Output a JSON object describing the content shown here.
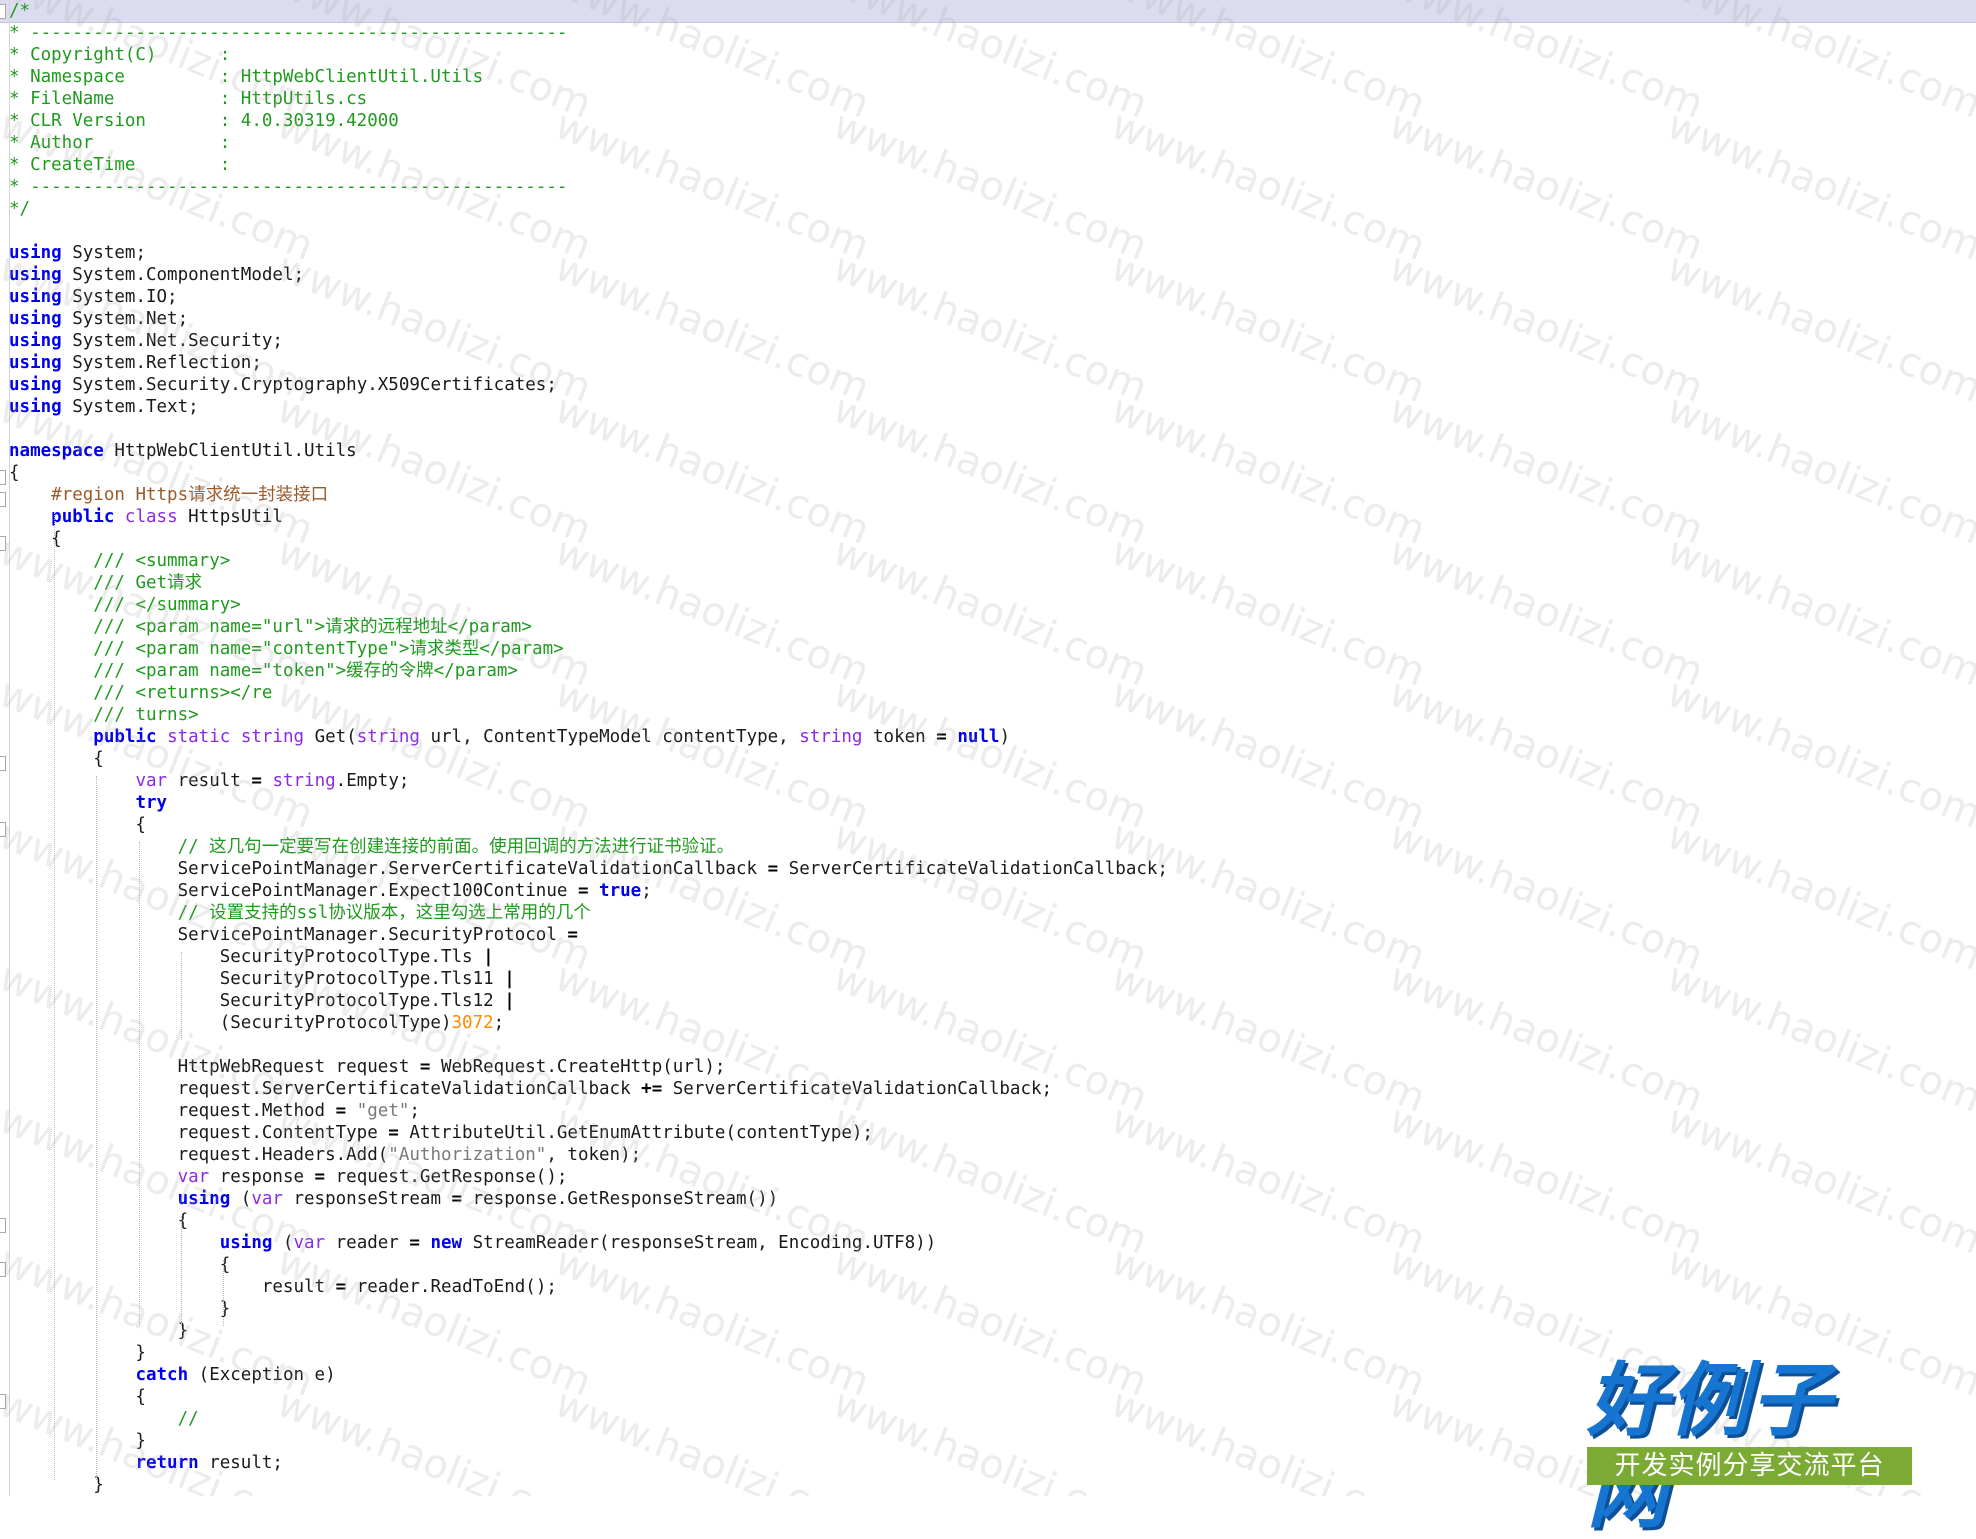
{
  "watermark": {
    "text": "www.haolizi.com"
  },
  "logo": {
    "title": "好例子网",
    "subtitle": "开发实例分享交流平台"
  },
  "code_lines": [
    [
      [
        "c",
        "/*"
      ]
    ],
    [
      [
        "c",
        "* ---------------------------------------------------"
      ]
    ],
    [
      [
        "c",
        "* Copyright(C)      :"
      ]
    ],
    [
      [
        "c",
        "* Namespace         : HttpWebClientUtil.Utils"
      ]
    ],
    [
      [
        "c",
        "* FileName          : HttpUtils.cs"
      ]
    ],
    [
      [
        "c",
        "* CLR Version       : 4.0.30319.42000"
      ]
    ],
    [
      [
        "c",
        "* Author            :"
      ]
    ],
    [
      [
        "c",
        "* CreateTime        :"
      ]
    ],
    [
      [
        "c",
        "* ---------------------------------------------------"
      ]
    ],
    [
      [
        "c",
        "*/"
      ]
    ],
    [],
    [
      [
        "k",
        "using"
      ],
      [
        "t",
        " System;"
      ]
    ],
    [
      [
        "k",
        "using"
      ],
      [
        "t",
        " System.ComponentModel;"
      ]
    ],
    [
      [
        "k",
        "using"
      ],
      [
        "t",
        " System.IO;"
      ]
    ],
    [
      [
        "k",
        "using"
      ],
      [
        "t",
        " System.Net;"
      ]
    ],
    [
      [
        "k",
        "using"
      ],
      [
        "t",
        " System.Net.Security;"
      ]
    ],
    [
      [
        "k",
        "using"
      ],
      [
        "t",
        " System.Reflection;"
      ]
    ],
    [
      [
        "k",
        "using"
      ],
      [
        "t",
        " System.Security.Cryptography.X509Certificates;"
      ]
    ],
    [
      [
        "k",
        "using"
      ],
      [
        "t",
        " System.Text;"
      ]
    ],
    [],
    [
      [
        "k",
        "namespace"
      ],
      [
        "t",
        " HttpWebClientUtil.Utils"
      ]
    ],
    [
      [
        "t",
        "{"
      ]
    ],
    [
      [
        "t",
        "    "
      ],
      [
        "r",
        "#region Https请求统一封装接口"
      ]
    ],
    [
      [
        "t",
        "    "
      ],
      [
        "k",
        "public"
      ],
      [
        "t",
        " "
      ],
      [
        "k2",
        "class"
      ],
      [
        "t",
        " HttpsUtil"
      ]
    ],
    [
      [
        "t",
        "    {"
      ]
    ],
    [
      [
        "t",
        "        "
      ],
      [
        "c",
        "/// <summary>"
      ]
    ],
    [
      [
        "t",
        "        "
      ],
      [
        "c",
        "/// Get请求"
      ]
    ],
    [
      [
        "t",
        "        "
      ],
      [
        "c",
        "/// </summary>"
      ]
    ],
    [
      [
        "t",
        "        "
      ],
      [
        "c",
        "/// <param name=\"url\">请求的远程地址</param>"
      ]
    ],
    [
      [
        "t",
        "        "
      ],
      [
        "c",
        "/// <param name=\"contentType\">请求类型</param>"
      ]
    ],
    [
      [
        "t",
        "        "
      ],
      [
        "c",
        "/// <param name=\"token\">缓存的令牌</param>"
      ]
    ],
    [
      [
        "t",
        "        "
      ],
      [
        "c",
        "/// <returns></re"
      ]
    ],
    [
      [
        "t",
        "        "
      ],
      [
        "c",
        "/// turns>"
      ]
    ],
    [
      [
        "t",
        "        "
      ],
      [
        "k",
        "public"
      ],
      [
        "t",
        " "
      ],
      [
        "k2",
        "static"
      ],
      [
        "t",
        " "
      ],
      [
        "k2",
        "string"
      ],
      [
        "t",
        " Get("
      ],
      [
        "k2",
        "string"
      ],
      [
        "t",
        " url, ContentTypeModel contentType, "
      ],
      [
        "k2",
        "string"
      ],
      [
        "t",
        " token "
      ],
      [
        "o",
        "="
      ],
      [
        "t",
        " "
      ],
      [
        "k",
        "null"
      ],
      [
        "t",
        ")"
      ]
    ],
    [
      [
        "t",
        "        {"
      ]
    ],
    [
      [
        "t",
        "            "
      ],
      [
        "k2",
        "var"
      ],
      [
        "t",
        " result "
      ],
      [
        "o",
        "="
      ],
      [
        "t",
        " "
      ],
      [
        "k2",
        "string"
      ],
      [
        "t",
        ".Empty;"
      ]
    ],
    [
      [
        "t",
        "            "
      ],
      [
        "k",
        "try"
      ]
    ],
    [
      [
        "t",
        "            {"
      ]
    ],
    [
      [
        "t",
        "                "
      ],
      [
        "c",
        "// 这几句一定要写在创建连接的前面。使用回调的方法进行证书验证。"
      ]
    ],
    [
      [
        "t",
        "                ServicePointManager.ServerCertificateValidationCallback "
      ],
      [
        "o",
        "="
      ],
      [
        "t",
        " ServerCertificateValidationCallback;"
      ]
    ],
    [
      [
        "t",
        "                ServicePointManager.Expect100Continue "
      ],
      [
        "o",
        "="
      ],
      [
        "t",
        " "
      ],
      [
        "k",
        "true"
      ],
      [
        "t",
        ";"
      ]
    ],
    [
      [
        "t",
        "                "
      ],
      [
        "c",
        "// 设置支持的ssl协议版本，这里勾选上常用的几个"
      ]
    ],
    [
      [
        "t",
        "                ServicePointManager.SecurityProtocol "
      ],
      [
        "o",
        "="
      ]
    ],
    [
      [
        "t",
        "                    SecurityProtocolType.Tls "
      ],
      [
        "o",
        "|"
      ]
    ],
    [
      [
        "t",
        "                    SecurityProtocolType.Tls11 "
      ],
      [
        "o",
        "|"
      ]
    ],
    [
      [
        "t",
        "                    SecurityProtocolType.Tls12 "
      ],
      [
        "o",
        "|"
      ]
    ],
    [
      [
        "t",
        "                    (SecurityProtocolType)"
      ],
      [
        "n",
        "3072"
      ],
      [
        "t",
        ";"
      ]
    ],
    [],
    [
      [
        "t",
        "                HttpWebRequest request "
      ],
      [
        "o",
        "="
      ],
      [
        "t",
        " WebRequest.CreateHttp(url);"
      ]
    ],
    [
      [
        "t",
        "                request.ServerCertificateValidationCallback "
      ],
      [
        "o",
        "+="
      ],
      [
        "t",
        " ServerCertificateValidationCallback;"
      ]
    ],
    [
      [
        "t",
        "                request.Method "
      ],
      [
        "o",
        "="
      ],
      [
        "t",
        " "
      ],
      [
        "s",
        "\"get\""
      ],
      [
        "t",
        ";"
      ]
    ],
    [
      [
        "t",
        "                request.ContentType "
      ],
      [
        "o",
        "="
      ],
      [
        "t",
        " AttributeUtil.GetEnumAttribute(contentType);"
      ]
    ],
    [
      [
        "t",
        "                request.Headers.Add("
      ],
      [
        "s",
        "\"Authorization\""
      ],
      [
        "t",
        ", token);"
      ]
    ],
    [
      [
        "t",
        "                "
      ],
      [
        "k2",
        "var"
      ],
      [
        "t",
        " response "
      ],
      [
        "o",
        "="
      ],
      [
        "t",
        " request.GetResponse();"
      ]
    ],
    [
      [
        "t",
        "                "
      ],
      [
        "k",
        "using"
      ],
      [
        "t",
        " ("
      ],
      [
        "k2",
        "var"
      ],
      [
        "t",
        " responseStream "
      ],
      [
        "o",
        "="
      ],
      [
        "t",
        " response.GetResponseStream())"
      ]
    ],
    [
      [
        "t",
        "                {"
      ]
    ],
    [
      [
        "t",
        "                    "
      ],
      [
        "k",
        "using"
      ],
      [
        "t",
        " ("
      ],
      [
        "k2",
        "var"
      ],
      [
        "t",
        " reader "
      ],
      [
        "o",
        "="
      ],
      [
        "t",
        " "
      ],
      [
        "k",
        "new"
      ],
      [
        "t",
        " StreamReader(responseStream, Encoding.UTF8))"
      ]
    ],
    [
      [
        "t",
        "                    {"
      ]
    ],
    [
      [
        "t",
        "                        result "
      ],
      [
        "o",
        "="
      ],
      [
        "t",
        " reader.ReadToEnd();"
      ]
    ],
    [
      [
        "t",
        "                    }"
      ]
    ],
    [
      [
        "t",
        "                }"
      ]
    ],
    [
      [
        "t",
        "            }"
      ]
    ],
    [
      [
        "t",
        "            "
      ],
      [
        "k",
        "catch"
      ],
      [
        "t",
        " (Exception e)"
      ]
    ],
    [
      [
        "t",
        "            {"
      ]
    ],
    [
      [
        "t",
        "                "
      ],
      [
        "c",
        "//"
      ]
    ],
    [
      [
        "t",
        "            }"
      ]
    ],
    [
      [
        "t",
        "            "
      ],
      [
        "k",
        "return"
      ],
      [
        "t",
        " result;"
      ]
    ],
    [
      [
        "t",
        "        }"
      ]
    ]
  ]
}
